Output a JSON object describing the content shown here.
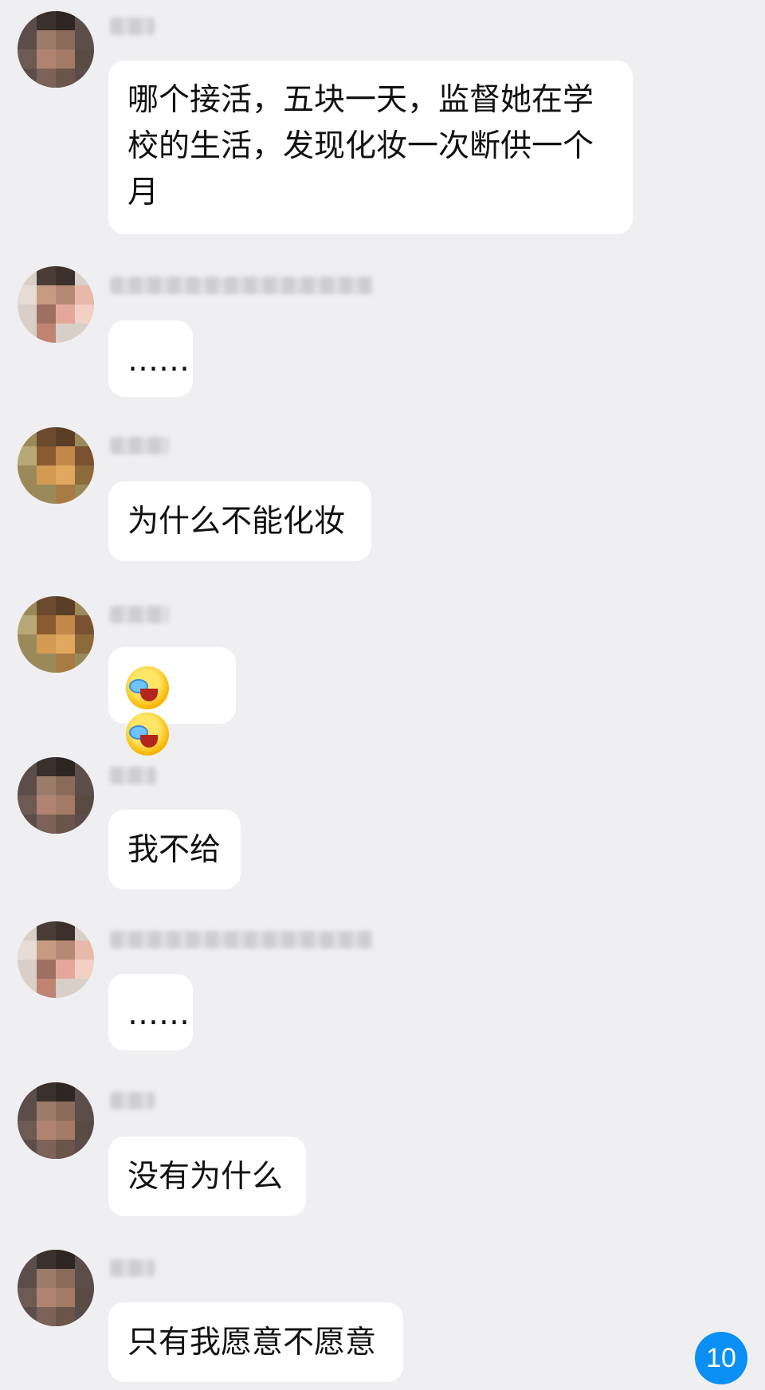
{
  "messages": [
    {
      "text": "哪个接活，五块一天，监督她在学校的生活，发现化妆一次断供一个月",
      "avatar": "avatar-a"
    },
    {
      "text": "……",
      "avatar": "avatar-b"
    },
    {
      "text": "为什么不能化妆",
      "avatar": "avatar-c"
    },
    {
      "emoji": [
        "laugh-cry-icon",
        "laugh-cry-icon"
      ],
      "avatar": "avatar-c"
    },
    {
      "text": "我不给",
      "avatar": "avatar-a"
    },
    {
      "text": "……",
      "avatar": "avatar-b"
    },
    {
      "text": "没有为什么",
      "avatar": "avatar-a"
    },
    {
      "text": "只有我愿意不愿意",
      "avatar": "avatar-a"
    }
  ],
  "unread_badge": "10",
  "colors": {
    "background": "#efeff1",
    "bubble": "#ffffff",
    "badge": "#0a8ff5"
  }
}
